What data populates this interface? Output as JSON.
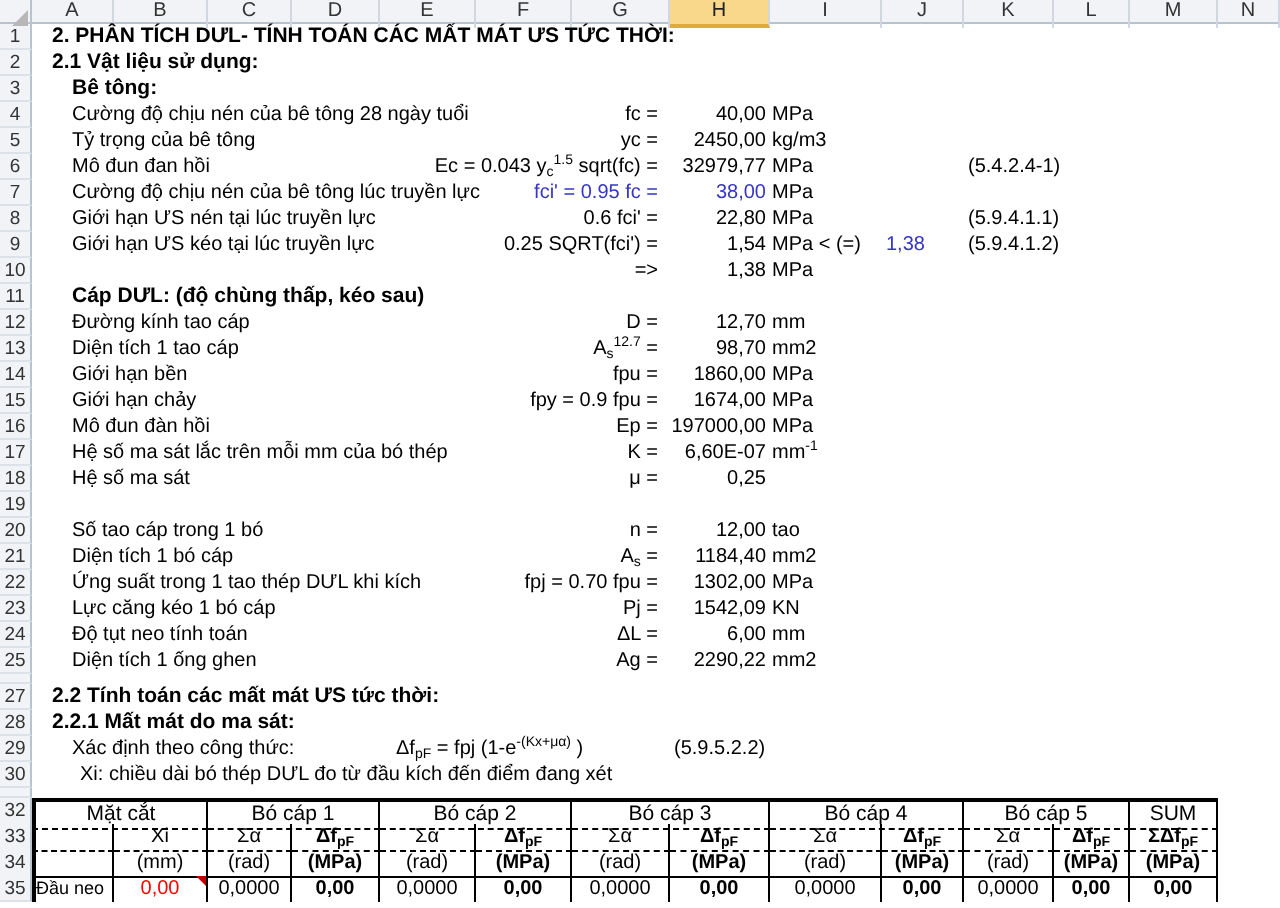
{
  "columns": [
    {
      "letter": "A",
      "selected": false
    },
    {
      "letter": "B",
      "selected": false
    },
    {
      "letter": "C",
      "selected": false
    },
    {
      "letter": "D",
      "selected": false
    },
    {
      "letter": "E",
      "selected": false
    },
    {
      "letter": "F",
      "selected": false
    },
    {
      "letter": "G",
      "selected": false
    },
    {
      "letter": "H",
      "selected": true
    },
    {
      "letter": "I",
      "selected": false
    },
    {
      "letter": "J",
      "selected": false
    },
    {
      "letter": "K",
      "selected": false
    },
    {
      "letter": "L",
      "selected": false
    },
    {
      "letter": "M",
      "selected": false
    },
    {
      "letter": "N",
      "selected": false
    }
  ],
  "rows": [
    {
      "number": "1",
      "kind": "heading",
      "text": "2. PHÂN TÍCH DƯL- TÍNH TOÁN CÁC MẤT MÁT ƯS TỨC THỜI:"
    },
    {
      "number": "2",
      "kind": "heading",
      "text": "2.1 Vật liệu sử dụng:"
    },
    {
      "number": "3",
      "kind": "subheading",
      "text": "Bê tông:"
    },
    {
      "number": "4",
      "kind": "param",
      "label": "Cường độ chịu nén của bê tông 28 ngày tuổi",
      "symbol": "fc =",
      "value": "40,00",
      "unit": "MPa",
      "highlight": false
    },
    {
      "number": "5",
      "kind": "param",
      "label": "Tỷ trọng của bê tông",
      "symbol": "yc =",
      "value": "2450,00",
      "unit": "kg/m3",
      "highlight": false
    },
    {
      "number": "6",
      "kind": "param",
      "label": "Mô đun đan hồi",
      "symbol": "Ec = 0.043 y$_{c}$$^{1.5}$ sqrt(fc) =",
      "value": "32979,77",
      "unit": "MPa",
      "ref": "(5.4.2.4-1)",
      "highlight": false
    },
    {
      "number": "7",
      "kind": "param",
      "label": "Cường độ chịu nén của bê tông lúc truyền lực",
      "symbol": "fci' = 0.95 fc =",
      "value": "38,00",
      "unit": "MPa",
      "highlight": true
    },
    {
      "number": "8",
      "kind": "param",
      "label": "Giới hạn ƯS nén tại lúc truyền lực",
      "symbol": "0.6 fci' =",
      "value": "22,80",
      "unit": "MPa",
      "ref": "(5.9.4.1.1)",
      "highlight": false
    },
    {
      "number": "9",
      "kind": "param",
      "label": "Giới hạn ƯS kéo tại lúc truyền lực",
      "symbol": "0.25 SQRT(fci') =",
      "value": "1,54",
      "unit": "MPa < (=)",
      "extra": "1,38",
      "ref": "(5.9.4.1.2)",
      "highlight": false
    },
    {
      "number": "10",
      "kind": "param",
      "symbol": "=>",
      "value": "1,38",
      "unit": "MPa",
      "highlight": false
    },
    {
      "number": "11",
      "kind": "subheading",
      "text": "Cáp DƯL: (độ chùng thấp, kéo sau)"
    },
    {
      "number": "12",
      "kind": "param",
      "label": "Đường kính tao cáp",
      "symbol": "D =",
      "value": "12,70",
      "unit": "mm",
      "highlight": false
    },
    {
      "number": "13",
      "kind": "param",
      "label": "Diện tích 1 tao cáp",
      "symbol": "A$_{s}$$^{12.7}$ =",
      "value": "98,70",
      "unit": "mm2",
      "highlight": false
    },
    {
      "number": "14",
      "kind": "param",
      "label": "Giới hạn bền",
      "symbol": "fpu =",
      "value": "1860,00",
      "unit": "MPa",
      "highlight": false
    },
    {
      "number": "15",
      "kind": "param",
      "label": "Giới hạn chảy",
      "symbol": "fpy = 0.9 fpu =",
      "value": "1674,00",
      "unit": "MPa",
      "highlight": false
    },
    {
      "number": "16",
      "kind": "param",
      "label": "Mô đun đàn hồi",
      "symbol": "Ep =",
      "value": "197000,00",
      "unit": "MPa",
      "highlight": false
    },
    {
      "number": "17",
      "kind": "param",
      "label": "Hệ số ma sát lắc trên mỗi mm của bó thép",
      "symbol": "K =",
      "value": "6,60E-07",
      "unit": "mm$^{-1}$",
      "highlight": false
    },
    {
      "number": "18",
      "kind": "param",
      "label": "Hệ số ma sát",
      "symbol": "μ =",
      "value": "0,25",
      "highlight": false
    },
    {
      "number": "19",
      "kind": "blank"
    },
    {
      "number": "20",
      "kind": "param",
      "label": "Số tao cáp trong 1 bó",
      "symbol": "n =",
      "value": "12,00",
      "unit": "tao",
      "highlight": false
    },
    {
      "number": "21",
      "kind": "param",
      "label": "Diện tích 1 bó cáp",
      "symbol": "A$_{s}$ =",
      "value": "1184,40",
      "unit": "mm2",
      "highlight": false
    },
    {
      "number": "22",
      "kind": "param",
      "label": "Ứng suất trong 1 tao thép DƯL khi kích",
      "symbol": "fpj = 0.70 fpu =",
      "value": "1302,00",
      "unit": "MPa",
      "highlight": false
    },
    {
      "number": "23",
      "kind": "param",
      "label": "Lực căng kéo 1 bó cáp",
      "symbol": "Pj =",
      "value": "1542,09",
      "unit": "KN",
      "highlight": false
    },
    {
      "number": "24",
      "kind": "param",
      "label": "Độ tụt neo tính toán",
      "symbol": "ΔL =",
      "value": "6,00",
      "unit": "mm",
      "highlight": false
    },
    {
      "number": "25",
      "kind": "param",
      "label": "Diện tích 1 ống ghen",
      "symbol": "Ag =",
      "value": "2290,22",
      "unit": "mm2",
      "highlight": false
    },
    {
      "kind": "collapsed"
    },
    {
      "number": "27",
      "kind": "heading",
      "text": "2.2 Tính toán các mất mát ƯS tức thời:"
    },
    {
      "number": "28",
      "kind": "heading",
      "text": "2.2.1 Mất mát do ma sát:"
    },
    {
      "number": "29",
      "kind": "formula",
      "label": "Xác định theo công thức:",
      "formula": "Δf$_{pF}$ = fpj (1-e$^{-(Kx+μα)}$ )",
      "formula_ref": "(5.9.5.2.2)"
    },
    {
      "number": "30",
      "kind": "note",
      "text": "Xi: chiều dài bó thép DƯL đo từ đầu kích đến điểm đang xét"
    },
    {
      "kind": "collapsed"
    }
  ],
  "table": {
    "header_row": {
      "number": "32",
      "groups": [
        {
          "label": "Mặt cắt"
        },
        {
          "label": "Bó cáp 1"
        },
        {
          "label": "Bó cáp 2"
        },
        {
          "label": "Bó cáp 3"
        },
        {
          "label": "Bó cáp 4"
        },
        {
          "label": "Bó cáp 5"
        },
        {
          "label": "SUM"
        }
      ]
    },
    "rows": [
      {
        "number": "33",
        "cells": [
          {
            "text": ""
          },
          {
            "text": "Xi"
          },
          {
            "text": "Σα"
          },
          {
            "text": "Δf$_{pF}$"
          },
          {
            "text": "Σα"
          },
          {
            "text": "Δf$_{pF}$"
          },
          {
            "text": "Σα"
          },
          {
            "text": "Δf$_{pF}$"
          },
          {
            "text": "Σα"
          },
          {
            "text": "Δf$_{pF}$"
          },
          {
            "text": "Σα"
          },
          {
            "text": "Δf$_{pF}$"
          },
          {
            "text": "ΣΔf$_{pF}$"
          }
        ]
      },
      {
        "number": "34",
        "cells": [
          {
            "text": ""
          },
          {
            "text": "(mm)"
          },
          {
            "text": "(rad)"
          },
          {
            "text": "(MPa)"
          },
          {
            "text": "(rad)"
          },
          {
            "text": "(MPa)"
          },
          {
            "text": "(rad)"
          },
          {
            "text": "(MPa)"
          },
          {
            "text": "(rad)"
          },
          {
            "text": "(MPa)"
          },
          {
            "text": "(rad)"
          },
          {
            "text": "(MPa)"
          },
          {
            "text": "(MPa)"
          }
        ]
      },
      {
        "number": "35",
        "cells": [
          {
            "text": "Đầu neo"
          },
          {
            "text": "0,00",
            "color": "#ff0000",
            "comment": true
          },
          {
            "text": "0,0000"
          },
          {
            "text": "0,00"
          },
          {
            "text": "0,0000"
          },
          {
            "text": "0,00"
          },
          {
            "text": "0,0000"
          },
          {
            "text": "0,00"
          },
          {
            "text": "0,0000"
          },
          {
            "text": "0,00"
          },
          {
            "text": "0,0000"
          },
          {
            "text": "0,00"
          },
          {
            "text": "0,00"
          }
        ]
      }
    ]
  }
}
